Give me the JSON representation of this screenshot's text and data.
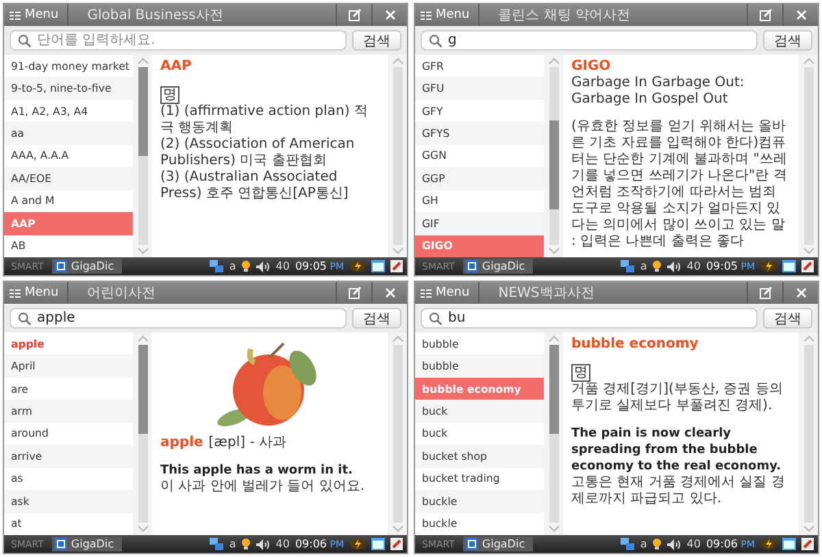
{
  "panels": [
    {
      "menu_label": "Menu",
      "title": "Global Business사전",
      "search": {
        "placeholder": "단어를 입력하세요."
      },
      "search_button": "검색",
      "kind": "fill-select",
      "list": [
        {
          "label": "91-day money market",
          "selected": false
        },
        {
          "label": "9-to-5, nine-to-five",
          "selected": false
        },
        {
          "label": "A1, A2, A3, A4",
          "selected": false
        },
        {
          "label": "aa",
          "selected": false
        },
        {
          "label": "AAA, A.A.A",
          "selected": false
        },
        {
          "label": "AA/EOE",
          "selected": false
        },
        {
          "label": "A and M",
          "selected": false
        },
        {
          "label": "AAP",
          "selected": true
        },
        {
          "label": "AB",
          "selected": false
        }
      ],
      "entry": [
        {
          "kind": "headword",
          "text": "AAP"
        },
        {
          "kind": "pos",
          "text": "명"
        },
        {
          "kind": "text",
          "text": "(1) (affirmative action plan) 적극 행동계획"
        },
        {
          "kind": "text",
          "text": "(2) (Association of American Publishers) 미국 출판협회"
        },
        {
          "kind": "text",
          "text": "(3) (Australian Associated Press) 호주 연합통신[AP통신]"
        }
      ],
      "taskbar": {
        "brand": "SMART",
        "app": "GigaDic",
        "input_mode": "a",
        "volume": "40",
        "time": "09:05",
        "ampm": "PM"
      }
    },
    {
      "menu_label": "Menu",
      "title": "콜린스 채팅 약어사전",
      "search": {
        "value": "g"
      },
      "search_button": "검색",
      "kind": "fill-select",
      "list": [
        {
          "label": "GFR",
          "selected": false
        },
        {
          "label": "GFU",
          "selected": false
        },
        {
          "label": "GFY",
          "selected": false
        },
        {
          "label": "GFYS",
          "selected": false
        },
        {
          "label": "GGN",
          "selected": false
        },
        {
          "label": "GGP",
          "selected": false
        },
        {
          "label": "GH",
          "selected": false
        },
        {
          "label": "GIF",
          "selected": false
        },
        {
          "label": "GIGO",
          "selected": true
        }
      ],
      "entry": [
        {
          "kind": "headword",
          "text": "GIGO"
        },
        {
          "kind": "text",
          "text": "Garbage In Garbage Out: Garbage In Gospel Out"
        },
        {
          "kind": "paragraph",
          "text": "(유효한 정보를 얻기 위해서는 올바른 기초 자료를 입력해야 한다)컴퓨터는 단순한 기계에 불과하며 \"쓰레기를 넣으면 쓰레기가 나온다\"란 격언처럼 조작하기에 따라서는 범죄 도구로 악용될 소지가 얼마든지 있다는 의미에서 많이 쓰이고 있는 말 : 입력은 나쁜데 출력은 좋다"
        }
      ],
      "taskbar": {
        "brand": "SMART",
        "app": "GigaDic",
        "input_mode": "a",
        "volume": "40",
        "time": "09:05",
        "ampm": "PM"
      }
    },
    {
      "menu_label": "Menu",
      "title": "어린이사전",
      "search": {
        "value": "apple"
      },
      "search_button": "검색",
      "kind": "text-select",
      "list": [
        {
          "label": "apple",
          "selected": true
        },
        {
          "label": "April",
          "selected": false
        },
        {
          "label": "are",
          "selected": false
        },
        {
          "label": "arm",
          "selected": false
        },
        {
          "label": "around",
          "selected": false
        },
        {
          "label": "arrive",
          "selected": false
        },
        {
          "label": "as",
          "selected": false
        },
        {
          "label": "ask",
          "selected": false
        },
        {
          "label": "at",
          "selected": false
        }
      ],
      "entry": [
        {
          "kind": "picture"
        },
        {
          "kind": "headline",
          "headword": "apple",
          "rest": "[æpl] - 사과"
        },
        {
          "kind": "example",
          "text": "This apple has a worm in it."
        },
        {
          "kind": "text",
          "text": "이 사과 안에 벌레가 들어 있어요."
        }
      ],
      "taskbar": {
        "brand": "SMART",
        "app": "GigaDic",
        "input_mode": "a",
        "volume": "40",
        "time": "09:06",
        "ampm": "PM"
      }
    },
    {
      "menu_label": "Menu",
      "title": "NEWS백과사전",
      "search": {
        "value": "bu"
      },
      "search_button": "검색",
      "kind": "fill-select",
      "list": [
        {
          "label": "bubble",
          "selected": false
        },
        {
          "label": "bubble",
          "selected": false
        },
        {
          "label": "bubble economy",
          "selected": true
        },
        {
          "label": "buck",
          "selected": false
        },
        {
          "label": "buck",
          "selected": false
        },
        {
          "label": "bucket shop",
          "selected": false
        },
        {
          "label": "bucket trading",
          "selected": false
        },
        {
          "label": "buckle",
          "selected": false
        },
        {
          "label": "buckle",
          "selected": false
        }
      ],
      "entry": [
        {
          "kind": "headword",
          "text": "bubble economy"
        },
        {
          "kind": "pos",
          "text": "명"
        },
        {
          "kind": "text",
          "text": "거품 경제[경기](부동산, 증권 등의 투기로 실제보다 부풀려진 경제)."
        },
        {
          "kind": "example",
          "text": "The pain is now clearly spreading from the bubble economy to the real economy."
        },
        {
          "kind": "text",
          "text": "고통은 현재 거품 경제에서 실질 경제로까지 파급되고 있다."
        }
      ],
      "taskbar": {
        "brand": "SMART",
        "app": "GigaDic",
        "input_mode": "a",
        "volume": "40",
        "time": "09:06",
        "ampm": "PM"
      }
    }
  ]
}
